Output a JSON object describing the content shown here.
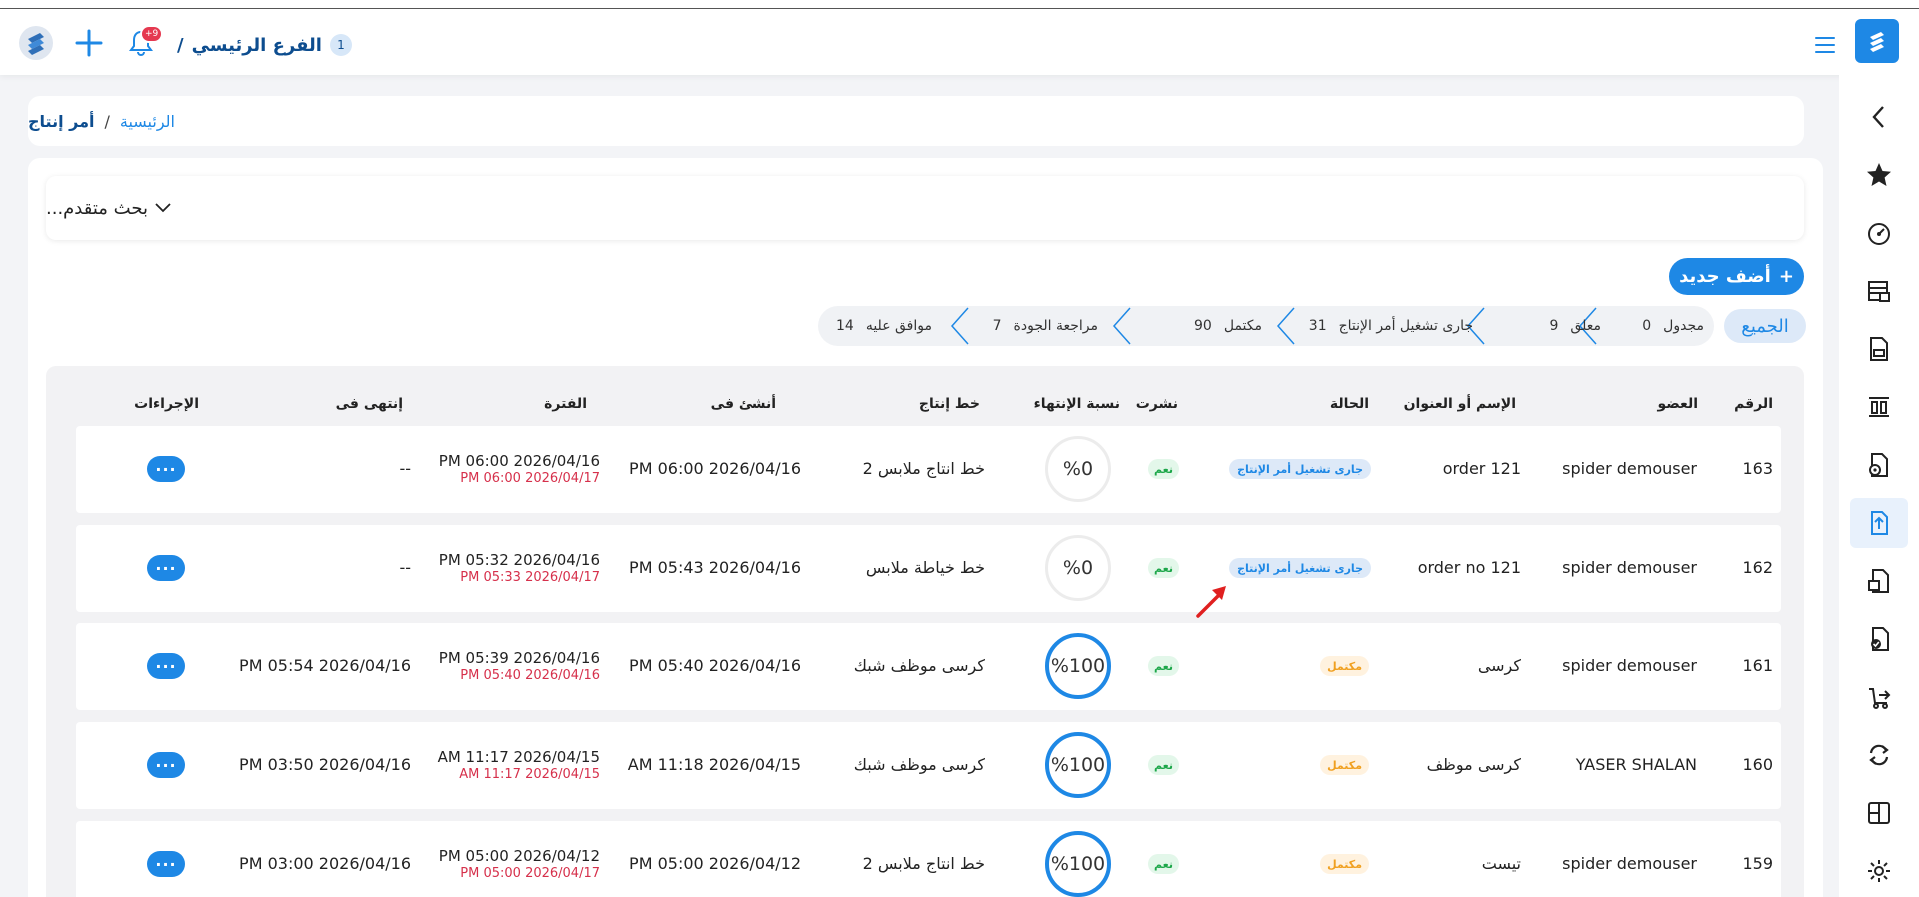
{
  "header": {
    "branch_number": "1",
    "branch_name": "الفرع الرئيسي",
    "branch_sep": "/",
    "notifications_badge": "+9"
  },
  "breadcrumb": {
    "home": "الرئيسية",
    "sep": "/",
    "current": "أمر إنتاج"
  },
  "search": {
    "label": "بحث متقدم..."
  },
  "add_button": {
    "label": "أضف جديد",
    "icon": "+"
  },
  "filters": {
    "all": "الجميع",
    "items": [
      {
        "label": "مجدول",
        "count": "0"
      },
      {
        "label": "معلق",
        "count": "9"
      },
      {
        "label": "جارى تشغيل أمر الإنتاج",
        "count": "31"
      },
      {
        "label": "مكتمل",
        "count": "90"
      },
      {
        "label": "مراجعة الجودة",
        "count": "7"
      },
      {
        "label": "موافق عليه",
        "count": "14"
      }
    ]
  },
  "table": {
    "headers": {
      "number": "الرقم",
      "member": "العضو",
      "name": "الإسم أو العنوان",
      "status": "الحالة",
      "published": "نشرت",
      "completion": "نسبة الإنتهاء",
      "line": "خط إنتاج",
      "created": "أنشئ فى",
      "period": "الفترة",
      "ended": "إنتهى فى",
      "actions": "الإجراءات"
    },
    "rows": [
      {
        "number": "163",
        "member": "spider demouser",
        "name": "order 121",
        "status": "جارى تشغيل أمر الإنتاج",
        "status_type": "running",
        "published": "نعم",
        "completion": "%0",
        "completion_value": 0,
        "line": "خط انتاج ملابس 2",
        "created": "2026/04/16 06:00 PM",
        "period_start": "2026/04/16 06:00 PM",
        "period_end": "2026/04/17 06:00 PM",
        "ended": "--"
      },
      {
        "number": "162",
        "member": "spider demouser",
        "name": "order no 121",
        "status": "جارى تشغيل أمر الإنتاج",
        "status_type": "running",
        "published": "نعم",
        "completion": "%0",
        "completion_value": 0,
        "line": "خط خياطة ملابس",
        "created": "2026/04/16 05:43 PM",
        "period_start": "2026/04/16 05:32 PM",
        "period_end": "2026/04/17 05:33 PM",
        "ended": "--"
      },
      {
        "number": "161",
        "member": "spider demouser",
        "name": "كرسى",
        "status": "مكتمل",
        "status_type": "done",
        "published": "نعم",
        "completion": "%100",
        "completion_value": 100,
        "line": "كرسى موظف شبك",
        "created": "2026/04/16 05:40 PM",
        "period_start": "2026/04/16 05:39 PM",
        "period_end": "2026/04/16 05:40 PM",
        "ended": "2026/04/16 05:54 PM"
      },
      {
        "number": "160",
        "member": "YASER SHALAN",
        "name": "كرسى موظف",
        "status": "مكتمل",
        "status_type": "done",
        "published": "نعم",
        "completion": "%100",
        "completion_value": 100,
        "line": "كرسى موظف شبك",
        "created": "2026/04/15 11:18 AM",
        "period_start": "2026/04/15 11:17 AM",
        "period_end": "2026/04/15 11:17 AM",
        "ended": "2026/04/16 03:50 PM"
      },
      {
        "number": "159",
        "member": "spider demouser",
        "name": "تيست",
        "status": "مكتمل",
        "status_type": "done",
        "published": "نعم",
        "completion": "%100",
        "completion_value": 100,
        "line": "خط انتاج ملابس 2",
        "created": "2026/04/12 05:00 PM",
        "period_start": "2026/04/12 05:00 PM",
        "period_end": "2026/04/17 05:00 PM",
        "ended": "2026/04/16 03:00 PM"
      }
    ],
    "actions_label": "···"
  },
  "colors": {
    "primary": "#1e88e5",
    "navy": "#0d4d8f",
    "danger": "#d6304b",
    "success": "#1da74a",
    "warning": "#f0a020"
  }
}
